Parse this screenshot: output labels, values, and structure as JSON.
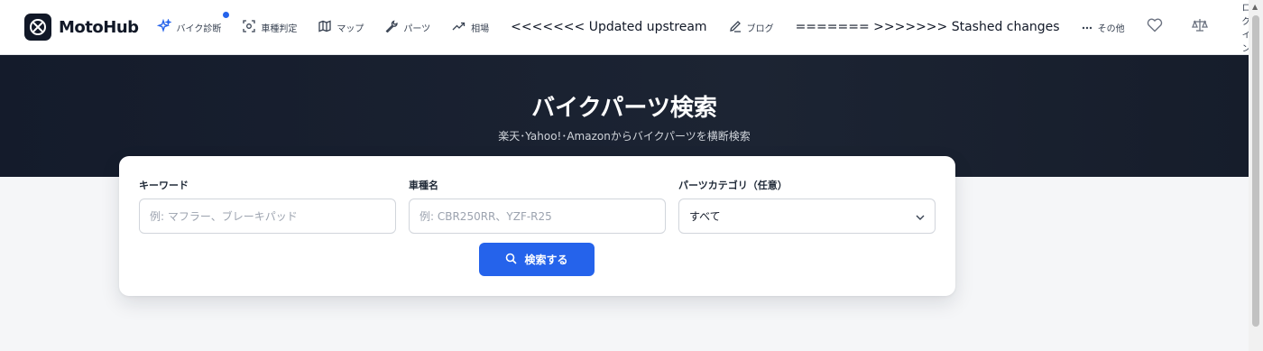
{
  "brand": {
    "name": "MotoHub"
  },
  "nav": {
    "items": [
      {
        "label": "バイク診断",
        "icon": "sparkle-icon",
        "active": true,
        "has_badge": true
      },
      {
        "label": "車種判定",
        "icon": "scan-icon"
      },
      {
        "label": "マップ",
        "icon": "map-icon"
      },
      {
        "label": "パーツ",
        "icon": "wrench-icon"
      },
      {
        "label": "相場",
        "icon": "trending-up-icon"
      }
    ],
    "conflict_upstream": "<<<<<<< Updated upstream",
    "blog_label": "ブログ",
    "conflict_stashed": "======= >>>>>>> Stashed changes",
    "more_label": "その他",
    "login_label": "ログイン"
  },
  "hero": {
    "title": "バイクパーツ検索",
    "subtitle": "楽天･Yahoo!･Amazonからバイクパーツを横断検索"
  },
  "search_form": {
    "keyword_label": "キーワード",
    "keyword_placeholder": "例: マフラー、ブレーキパッド",
    "keyword_value": "",
    "model_label": "車種名",
    "model_placeholder": "例: CBR250RR、YZF-R25",
    "model_value": "",
    "category_label": "パーツカテゴリ（任意）",
    "category_value": "すべて",
    "submit_label": "検索する"
  },
  "colors": {
    "accent": "#2563eb",
    "hero_bg": "#182030",
    "page_bg": "#f5f6f8"
  }
}
